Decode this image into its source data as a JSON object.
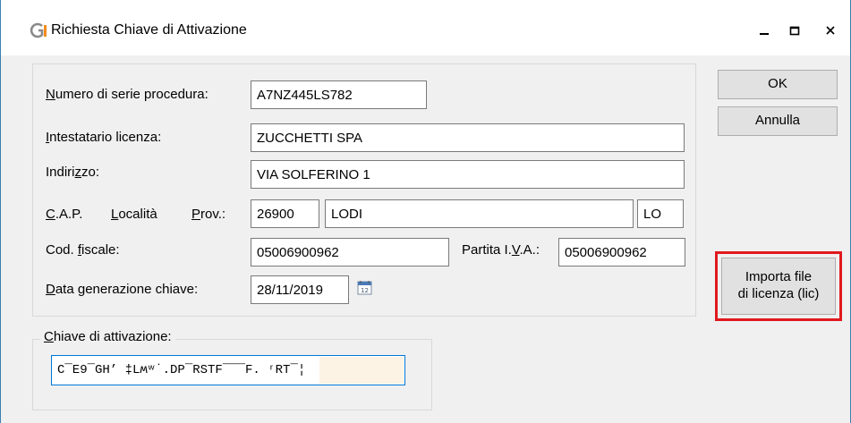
{
  "window": {
    "title": "Richiesta Chiave di Attivazione",
    "icon": "app-logo-icon",
    "controls": {
      "minimize": "–",
      "maximize": "□",
      "close": "×"
    }
  },
  "form": {
    "serial": {
      "label_pre": "",
      "label_ul": "N",
      "label_post": "umero di serie procedura:",
      "value": "A7NZ445LS782"
    },
    "holder": {
      "label_pre": "",
      "label_ul": "I",
      "label_post": "ntestatario licenza:",
      "value": "ZUCCHETTI SPA"
    },
    "address": {
      "label_pre": "Indiri",
      "label_ul": "z",
      "label_post": "zo:",
      "value": "VIA SOLFERINO 1"
    },
    "cap": {
      "label_pre": "",
      "label_ul": "C",
      "label_post": ".A.P.",
      "value": "26900"
    },
    "city": {
      "label_pre": "",
      "label_ul": "L",
      "label_post": "ocalità",
      "value": "LODI"
    },
    "province": {
      "label_pre": "",
      "label_ul": "P",
      "label_post": "rov.:",
      "value": "LO"
    },
    "fiscal_code": {
      "label_pre": "Cod. ",
      "label_ul": "f",
      "label_post": "iscale:",
      "value": "05006900962"
    },
    "vat": {
      "label_pre": "Partita I.",
      "label_ul": "V",
      "label_post": ".A.:",
      "value": "05006900962"
    },
    "date": {
      "label_pre": "",
      "label_ul": "D",
      "label_post": "ata generazione chiave:",
      "value": "28/11/2019",
      "icon": "calendar-icon"
    }
  },
  "key_group": {
    "title_pre": "",
    "title_ul": "C",
    "title_post": "hiave di attivazione:",
    "value": "C‾E9‾GH’ ‡Lʍʷ˙.DP‾RSTF‾‾‾F. ʳRT‾¦"
  },
  "buttons": {
    "ok": "OK",
    "cancel": "Annulla",
    "import_line1": "Importa file",
    "import_line2": "di licenza (lic)"
  },
  "colors": {
    "highlight_frame": "#e0191e",
    "window_border": "#3c7fb1",
    "focus_border": "#0078d7",
    "logo_gray": "#8a8a8a",
    "logo_orange": "#f28c1e"
  }
}
